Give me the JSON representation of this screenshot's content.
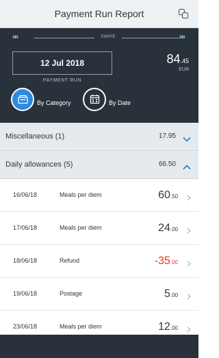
{
  "header": {
    "title": "Payment Run Report",
    "action_icon": "copy-icon"
  },
  "summary": {
    "swipe_label": "SWIPE",
    "date": "12 Jul 2018",
    "run_label": "PAYMENT RUN",
    "total_whole": "84",
    "total_cents": ".45",
    "currency": "EUR"
  },
  "views": [
    {
      "label": "By Category",
      "icon": "category-icon",
      "active": true
    },
    {
      "label": "By Date",
      "icon": "calendar-icon",
      "active": false
    }
  ],
  "groups": [
    {
      "title": "Miscellaneous (1)",
      "amount": "17.95",
      "expanded": false
    },
    {
      "title": "Daily allowances (5)",
      "amount": "66.50",
      "expanded": true
    }
  ],
  "items": [
    {
      "date": "16/06/18",
      "description": "Meals per diem",
      "whole": "60",
      "cents": ".50",
      "negative": false
    },
    {
      "date": "17/06/18",
      "description": "Meals per diem",
      "whole": "24",
      "cents": ".00",
      "negative": false
    },
    {
      "date": "18/06/18",
      "description": "Refund",
      "whole": "-35",
      "cents": ".00",
      "negative": true
    },
    {
      "date": "19/06/18",
      "description": "Postage",
      "whole": "5",
      "cents": ".00",
      "negative": false
    },
    {
      "date": "23/06/18",
      "description": "Meals per diem",
      "whole": "12",
      "cents": ".00",
      "negative": false
    }
  ],
  "colors": {
    "accent": "#2d8ae0",
    "negative": "#e8321c",
    "hero_bg": "#29313a",
    "group_bg": "#e5eaee"
  }
}
